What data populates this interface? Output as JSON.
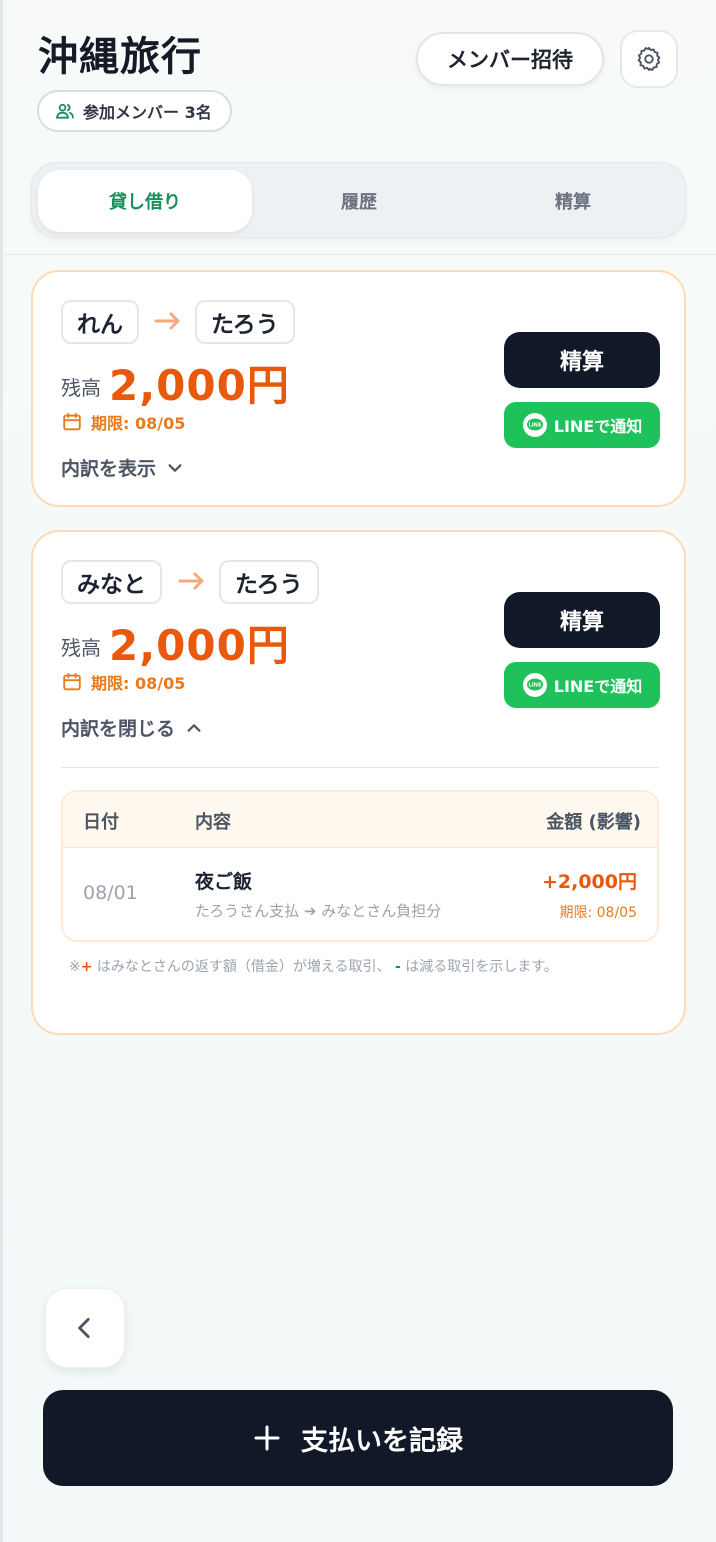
{
  "header": {
    "title": "沖縄旅行",
    "members_label": "参加メンバー 3名",
    "invite_label": "メンバー招待"
  },
  "tabs": [
    {
      "label": "貸し借り",
      "active": true
    },
    {
      "label": "履歴",
      "active": false
    },
    {
      "label": "精算",
      "active": false
    }
  ],
  "cards": [
    {
      "from": "れん",
      "to": "たろう",
      "balance_label": "残高",
      "balance": "2,000円",
      "deadline": "期限: 08/05",
      "toggle_label": "内訳を表示",
      "expanded": false,
      "settle_label": "精算",
      "line_label": "LINEで通知"
    },
    {
      "from": "みなと",
      "to": "たろう",
      "balance_label": "残高",
      "balance": "2,000円",
      "deadline": "期限: 08/05",
      "toggle_label": "内訳を閉じる",
      "expanded": true,
      "settle_label": "精算",
      "line_label": "LINEで通知",
      "table": {
        "headers": {
          "date": "日付",
          "content": "内容",
          "amount": "金額 (影響)"
        },
        "rows": [
          {
            "date": "08/01",
            "title": "夜ご飯",
            "subtitle": "たろうさん支払 ➔ みなとさん負担分",
            "amount": "+2,000円",
            "deadline": "期限: 08/05"
          }
        ]
      },
      "note": {
        "prefix": "※",
        "plus": "+",
        "mid": " はみなとさんの返す額（借金）が増える取引、 ",
        "minus": "-",
        "suffix": " は減る取引を示します。"
      }
    }
  ],
  "footer": {
    "record_label": "支払いを記録"
  },
  "colors": {
    "accent_orange": "#ea580c",
    "accent_green": "#16915a",
    "line_green": "#1fc25a",
    "dark": "#111827"
  },
  "icons": [
    "users-icon",
    "gear-icon",
    "arrow-right-icon",
    "calendar-icon",
    "chevron-down-icon",
    "chevron-up-icon",
    "line-icon",
    "chevron-left-icon",
    "plus-icon"
  ]
}
